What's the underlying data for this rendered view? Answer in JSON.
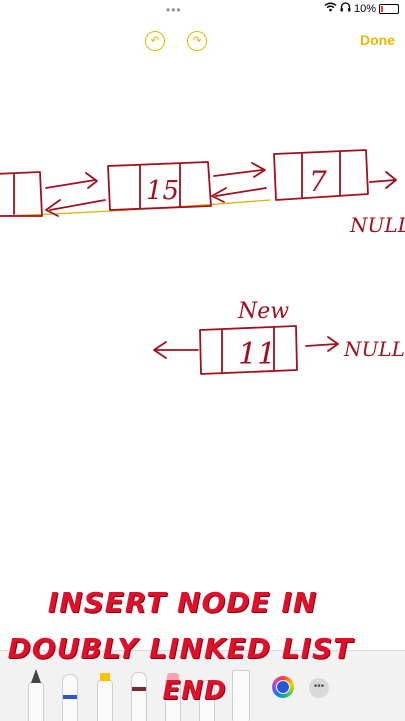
{
  "status_bar": {
    "more_glyph": "•••",
    "battery_text": "10%",
    "battery_level": 0.1
  },
  "toolbar": {
    "undo_glyph": "↶",
    "redo_glyph": "↷",
    "done_label": "Done"
  },
  "drawing": {
    "node_values": [
      "15",
      "7"
    ],
    "null_label_1": "NULL",
    "new_label": "New",
    "new_node_value": "11",
    "null_label_2": "NULL",
    "ink_color": "#a0101e",
    "baseline_color": "#d9b400"
  },
  "title_lines": [
    "INSERT NODE IN",
    "DOUBLY LINKED LIST",
    "END"
  ],
  "colors": {
    "accent": "#e6b800",
    "title": "#e0102a"
  }
}
